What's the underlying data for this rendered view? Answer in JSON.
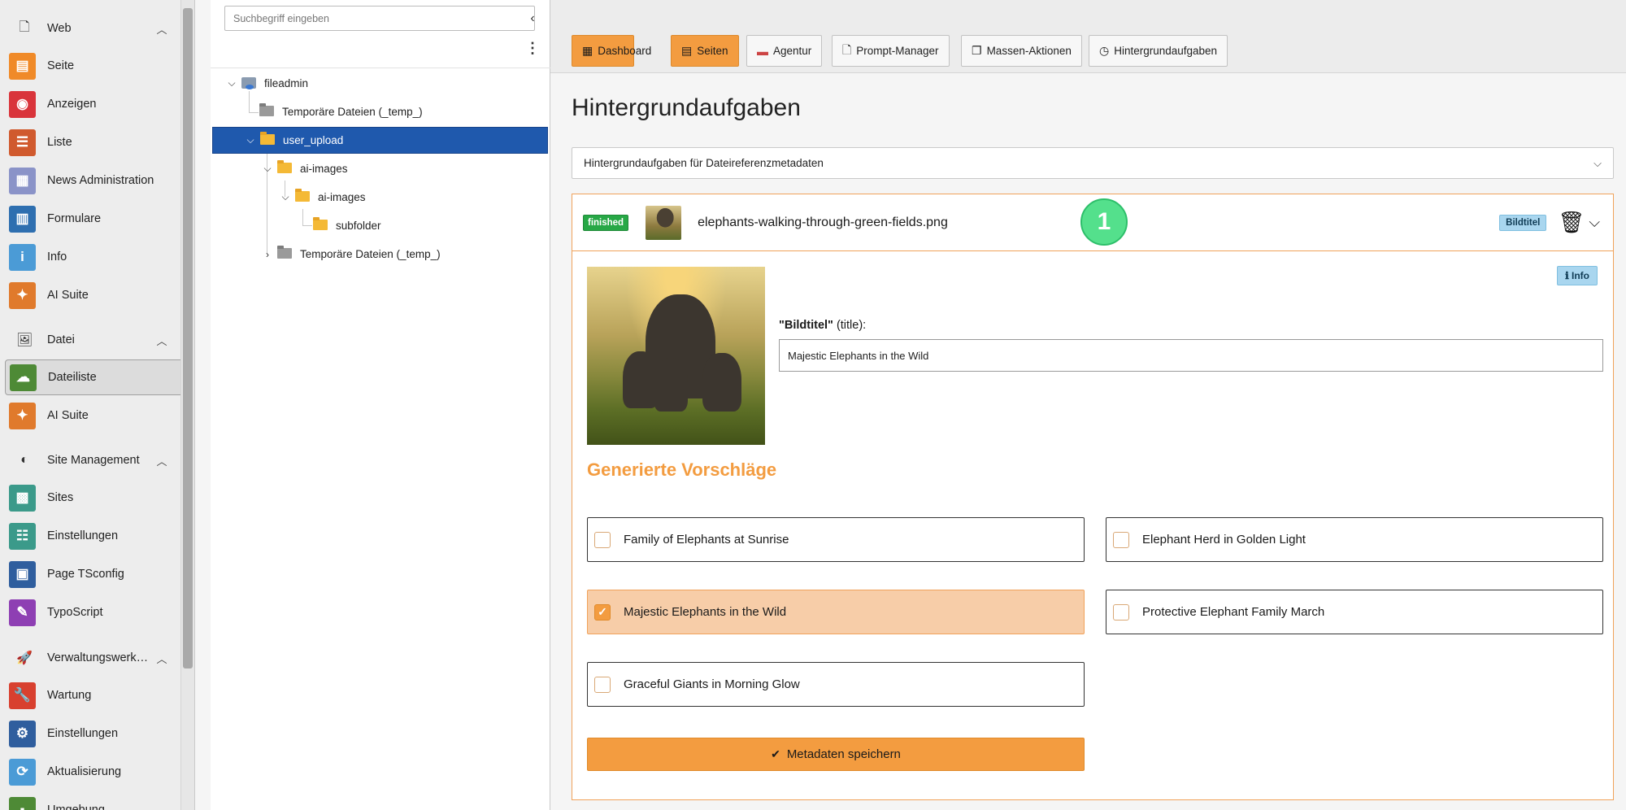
{
  "sidebar": {
    "groups": [
      {
        "label": "Web",
        "icon": "page-icon",
        "glyph": "🗋"
      },
      {
        "label": "Datei",
        "icon": "image-icon",
        "glyph": "🖼"
      },
      {
        "label": "Site Management",
        "icon": "globe-icon",
        "glyph": "◐"
      },
      {
        "label": "Verwaltungswerkze…",
        "icon": "rocket-icon",
        "glyph": "🚀"
      }
    ],
    "items": [
      {
        "label": "Seite",
        "color": "#f08a28",
        "glyph": "▤"
      },
      {
        "label": "Anzeigen",
        "color": "#d9343b",
        "glyph": "◉"
      },
      {
        "label": "Liste",
        "color": "#d05a2e",
        "glyph": "☰"
      },
      {
        "label": "News Administration",
        "color": "#8a93c8",
        "glyph": "▦"
      },
      {
        "label": "Formulare",
        "color": "#2e6fb0",
        "glyph": "▥"
      },
      {
        "label": "Info",
        "color": "#4b9bd6",
        "glyph": "i"
      },
      {
        "label": "AI Suite",
        "color": "#e07a2c",
        "glyph": "✦"
      },
      {
        "label": "Dateiliste",
        "color": "#4e8a36",
        "glyph": "☁"
      },
      {
        "label": "AI Suite",
        "color": "#e07a2c",
        "glyph": "✦"
      },
      {
        "label": "Sites",
        "color": "#3b9a8a",
        "glyph": "▩"
      },
      {
        "label": "Einstellungen",
        "color": "#3b9a8a",
        "glyph": "☷"
      },
      {
        "label": "Page TSconfig",
        "color": "#2f5e9e",
        "glyph": "▣"
      },
      {
        "label": "TypoScript",
        "color": "#8e3fb3",
        "glyph": "✎"
      },
      {
        "label": "Wartung",
        "color": "#d8402f",
        "glyph": "🔧"
      },
      {
        "label": "Einstellungen",
        "color": "#2f5e9e",
        "glyph": "⚙"
      },
      {
        "label": "Aktualisierung",
        "color": "#4b9bd6",
        "glyph": "⟳"
      },
      {
        "label": "Umgebung",
        "color": "#4e8a36",
        "glyph": "▪"
      }
    ]
  },
  "tree": {
    "search_placeholder": "Suchbegriff eingeben",
    "nodes": [
      {
        "label": "fileadmin"
      },
      {
        "label": "Temporäre Dateien (_temp_)"
      },
      {
        "label": "user_upload"
      },
      {
        "label": "ai-images"
      },
      {
        "label": "ai-images"
      },
      {
        "label": "subfolder"
      },
      {
        "label": "Temporäre Dateien (_temp_)"
      }
    ]
  },
  "toolbar": {
    "buttons": [
      {
        "label": "Dashboard",
        "glyph": "▦"
      },
      {
        "label": "Seiten",
        "glyph": "▤"
      },
      {
        "label": "Agentur",
        "glyph": "▬"
      },
      {
        "label": "Prompt-Manager",
        "glyph": "🗋"
      },
      {
        "label": "Massen-Aktionen",
        "glyph": "❐"
      },
      {
        "label": "Hintergrundaufgaben",
        "glyph": "◷"
      }
    ]
  },
  "main": {
    "title": "Hintergrundaufgaben",
    "select_value": "Hintergrundaufgaben für Dateireferenzmetadaten",
    "task": {
      "status": "finished",
      "filename": "elephants-walking-through-green-fields.png",
      "type_badge": "Bildtitel",
      "info_label": "Info",
      "field_label_bold": "\"Bildtitel\"",
      "field_label_rest": " (title):",
      "field_value": "Majestic Elephants in the Wild",
      "suggestions_title": "Generierte Vorschläge",
      "suggestions": [
        {
          "label": "Family of Elephants at Sunrise",
          "checked": false
        },
        {
          "label": "Elephant Herd in Golden Light",
          "checked": false
        },
        {
          "label": "Majestic Elephants in the Wild",
          "checked": true
        },
        {
          "label": "Protective Elephant Family March",
          "checked": false
        },
        {
          "label": "Graceful Giants in Morning Glow",
          "checked": false
        }
      ],
      "save_label": "Metadaten speichern"
    },
    "step_marker": "1"
  },
  "colors": {
    "accent": "#f39c40",
    "selected_tree": "#1f59ad",
    "finished": "#27a846",
    "info": "#a9d6ef"
  }
}
